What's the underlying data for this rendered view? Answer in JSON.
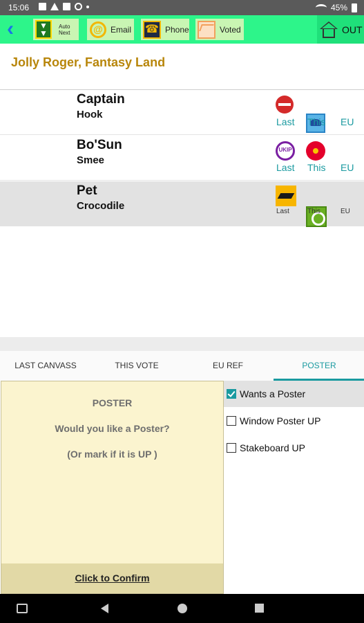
{
  "status_bar": {
    "time": "15:06",
    "battery": "45%",
    "icons": [
      "image-icon",
      "warning-icon",
      "mail-icon",
      "settings-icon",
      "dot-icon",
      "wifi-icon",
      "battery-icon"
    ]
  },
  "toolbar": {
    "back_icon": "back-arrow-icon",
    "auto_next_line1": "Auto",
    "auto_next_line2": "Next",
    "email_label": "Email",
    "phone_label": "Phone",
    "voted_label": "Voted",
    "out_label": "OUT",
    "background_color": "#2df58a"
  },
  "address": "Jolly Roger, Fantasy Land",
  "voters": [
    {
      "title": "Captain",
      "name": "Hook",
      "last_icon": "no-entry-icon",
      "this_icon": "blue-tree-icon",
      "last_label": "Last",
      "this_label": "This",
      "eu_label": "EU"
    },
    {
      "title": "Bo'Sun",
      "name": "Smee",
      "last_icon": "ukip-icon",
      "this_icon": "red-rose-icon",
      "last_label": "Last",
      "this_label": "This",
      "eu_label": "EU"
    },
    {
      "title": "Pet",
      "name": "Crocodile",
      "last_icon": "libdem-bird-icon",
      "this_icon": "green-party-icon",
      "last_label": "Last",
      "this_label": "This",
      "eu_label": "EU",
      "selected": true
    }
  ],
  "ukip_text": "UKIP",
  "tabs": [
    {
      "label": "LAST CANVASS"
    },
    {
      "label": "THIS VOTE"
    },
    {
      "label": "EU REF"
    },
    {
      "label": "POSTER",
      "active": true
    }
  ],
  "poster_panel": {
    "title": "POSTER",
    "question": "Would you like a Poster?",
    "note": "(Or mark if it is UP )",
    "confirm_label": "Click to Confirm"
  },
  "options": [
    {
      "label": "Wants a Poster",
      "checked": true
    },
    {
      "label": "Window Poster UP",
      "checked": false
    },
    {
      "label": "Stakeboard UP",
      "checked": false
    }
  ],
  "colors": {
    "accent": "#1a9aa0",
    "address": "#b8860b",
    "panel_bg": "#fbf4cf"
  }
}
